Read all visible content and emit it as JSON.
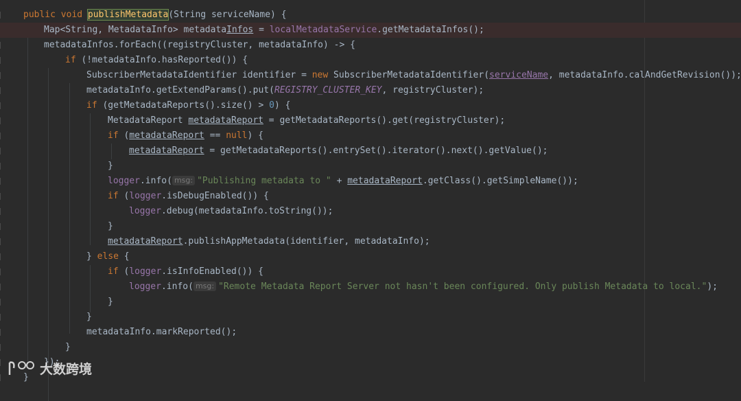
{
  "editor": {
    "language": "java",
    "lines": [
      {
        "segments": [
          {
            "t": "public void ",
            "c": "kw"
          },
          {
            "t": "publishMetadata",
            "c": "fn-decl"
          },
          {
            "t": "(String serviceName) {",
            "c": ""
          }
        ]
      },
      {
        "segments": [
          {
            "t": "Map<String, MetadataInfo> metadata",
            "c": ""
          },
          {
            "t": "Infos",
            "c": "u"
          },
          {
            "t": " = ",
            "c": ""
          },
          {
            "t": "localMetadataService",
            "c": "fld"
          },
          {
            "t": ".getMetadataInfos();",
            "c": ""
          }
        ]
      },
      {
        "segments": [
          {
            "t": "metadataInfos.forEach((registryCluster, metadataInfo) -> {",
            "c": ""
          }
        ]
      },
      {
        "segments": [
          {
            "t": "if ",
            "c": "kw"
          },
          {
            "t": "(!metadataInfo.hasReported()) {",
            "c": ""
          }
        ]
      },
      {
        "segments": [
          {
            "t": "SubscriberMetadataIdentifier identifier = ",
            "c": ""
          },
          {
            "t": "new ",
            "c": "kw"
          },
          {
            "t": "SubscriberMetadataIdentifier(",
            "c": ""
          },
          {
            "t": "serviceName",
            "c": "fld-u"
          },
          {
            "t": ", metadataInfo.calAndGetRevision());",
            "c": ""
          }
        ]
      },
      {
        "segments": [
          {
            "t": "metadataInfo.getExtendParams().put(",
            "c": ""
          },
          {
            "t": "REGISTRY_CLUSTER_KEY",
            "c": "const"
          },
          {
            "t": ", registryCluster);",
            "c": ""
          }
        ]
      },
      {
        "segments": [
          {
            "t": "if ",
            "c": "kw"
          },
          {
            "t": "(getMetadataReports().size() > ",
            "c": ""
          },
          {
            "t": "0",
            "c": "num"
          },
          {
            "t": ") {",
            "c": ""
          }
        ]
      },
      {
        "segments": [
          {
            "t": "MetadataReport ",
            "c": ""
          },
          {
            "t": "metadataReport",
            "c": "u"
          },
          {
            "t": " = getMetadataReports().get(registryCluster);",
            "c": ""
          }
        ]
      },
      {
        "segments": [
          {
            "t": "if ",
            "c": "kw"
          },
          {
            "t": "(",
            "c": ""
          },
          {
            "t": "metadataReport",
            "c": "u"
          },
          {
            "t": " == ",
            "c": ""
          },
          {
            "t": "null",
            "c": "kw"
          },
          {
            "t": ") {",
            "c": ""
          }
        ]
      },
      {
        "segments": [
          {
            "t": "metadataReport",
            "c": "u"
          },
          {
            "t": " = getMetadataReports().entrySet().iterator().next().getValue();",
            "c": ""
          }
        ]
      },
      {
        "segments": [
          {
            "t": "}",
            "c": ""
          }
        ]
      },
      {
        "segments": [
          {
            "t": "logger",
            "c": "fld"
          },
          {
            "t": ".info(",
            "c": ""
          },
          {
            "t": "msg:",
            "c": "hint"
          },
          {
            "t": "\"Publishing metadata to \"",
            "c": "str"
          },
          {
            "t": " + ",
            "c": ""
          },
          {
            "t": "metadataReport",
            "c": "u"
          },
          {
            "t": ".getClass().getSimpleName());",
            "c": ""
          }
        ]
      },
      {
        "segments": [
          {
            "t": "if ",
            "c": "kw"
          },
          {
            "t": "(",
            "c": ""
          },
          {
            "t": "logger",
            "c": "fld"
          },
          {
            "t": ".isDebugEnabled()) {",
            "c": ""
          }
        ]
      },
      {
        "segments": [
          {
            "t": "logger",
            "c": "fld"
          },
          {
            "t": ".debug(metadataInfo.toString());",
            "c": ""
          }
        ]
      },
      {
        "segments": [
          {
            "t": "}",
            "c": ""
          }
        ]
      },
      {
        "segments": [
          {
            "t": "metadataReport",
            "c": "u"
          },
          {
            "t": ".publishAppMetadata(identifier, metadataInfo);",
            "c": ""
          }
        ]
      },
      {
        "segments": [
          {
            "t": "} ",
            "c": ""
          },
          {
            "t": "else ",
            "c": "kw"
          },
          {
            "t": "{",
            "c": ""
          }
        ]
      },
      {
        "segments": [
          {
            "t": "if ",
            "c": "kw"
          },
          {
            "t": "(",
            "c": ""
          },
          {
            "t": "logger",
            "c": "fld"
          },
          {
            "t": ".isInfoEnabled()) {",
            "c": ""
          }
        ]
      },
      {
        "segments": [
          {
            "t": "logger",
            "c": "fld"
          },
          {
            "t": ".info(",
            "c": ""
          },
          {
            "t": "msg:",
            "c": "hint"
          },
          {
            "t": "\"Remote Metadata Report Server not hasn't been configured. Only publish Metadata to local.\"",
            "c": "str"
          },
          {
            "t": ");",
            "c": ""
          }
        ]
      },
      {
        "segments": [
          {
            "t": "}",
            "c": ""
          }
        ]
      },
      {
        "segments": [
          {
            "t": "}",
            "c": ""
          }
        ]
      },
      {
        "segments": [
          {
            "t": "metadataInfo.markReported();",
            "c": ""
          }
        ]
      },
      {
        "segments": [
          {
            "t": "}",
            "c": ""
          }
        ]
      },
      {
        "segments": [
          {
            "t": "});",
            "c": ""
          }
        ]
      },
      {
        "segments": [
          {
            "t": "}",
            "c": ""
          }
        ]
      }
    ]
  },
  "watermark": {
    "text": "大数跨境"
  }
}
